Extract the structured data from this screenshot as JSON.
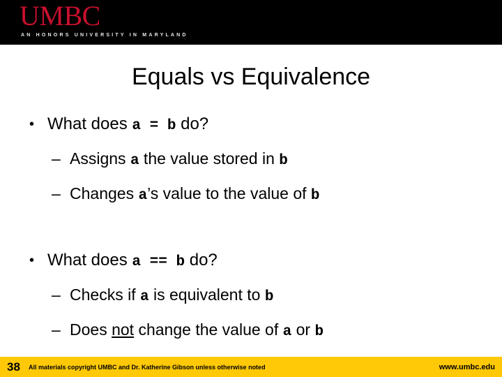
{
  "header": {
    "background_color": "#000000",
    "logo_wordmark": "UMBC",
    "logo_wordmark_color": "#c8102e",
    "logo_tagline": "AN HONORS UNIVERSITY IN MARYLAND"
  },
  "slide": {
    "title": "Equals vs Equivalence",
    "bullets": [
      {
        "marker": "•",
        "segments": [
          {
            "text": "What does ",
            "style": "plain"
          },
          {
            "text": "a",
            "style": "code"
          },
          {
            "text": " = ",
            "style": "code"
          },
          {
            "text": "b",
            "style": "code"
          },
          {
            "text": " do?",
            "style": "plain"
          }
        ],
        "children": [
          {
            "marker": "–",
            "segments": [
              {
                "text": "Assigns ",
                "style": "plain"
              },
              {
                "text": "a",
                "style": "code"
              },
              {
                "text": " the value stored in ",
                "style": "plain"
              },
              {
                "text": "b",
                "style": "code"
              }
            ]
          },
          {
            "marker": "–",
            "segments": [
              {
                "text": "Changes ",
                "style": "plain"
              },
              {
                "text": "a",
                "style": "code"
              },
              {
                "text": "’s value to the value of ",
                "style": "plain"
              },
              {
                "text": "b",
                "style": "code"
              }
            ]
          }
        ]
      },
      {
        "marker": "•",
        "segments": [
          {
            "text": "What does ",
            "style": "plain"
          },
          {
            "text": "a",
            "style": "code"
          },
          {
            "text": " == ",
            "style": "code"
          },
          {
            "text": "b",
            "style": "code"
          },
          {
            "text": " do?",
            "style": "plain"
          }
        ],
        "children": [
          {
            "marker": "–",
            "segments": [
              {
                "text": "Checks if ",
                "style": "plain"
              },
              {
                "text": "a",
                "style": "code"
              },
              {
                "text": " is equivalent to ",
                "style": "plain"
              },
              {
                "text": "b",
                "style": "code"
              }
            ]
          },
          {
            "marker": "–",
            "segments": [
              {
                "text": "Does ",
                "style": "plain"
              },
              {
                "text": "not",
                "style": "underline"
              },
              {
                "text": " change the value of ",
                "style": "plain"
              },
              {
                "text": "a",
                "style": "code"
              },
              {
                "text": " or ",
                "style": "plain"
              },
              {
                "text": "b",
                "style": "code"
              }
            ]
          }
        ]
      }
    ]
  },
  "footer": {
    "background_color": "#ffc907",
    "page_number": "38",
    "copyright": "All materials copyright UMBC and Dr. Katherine Gibson unless otherwise noted",
    "url": "www.umbc.edu"
  }
}
